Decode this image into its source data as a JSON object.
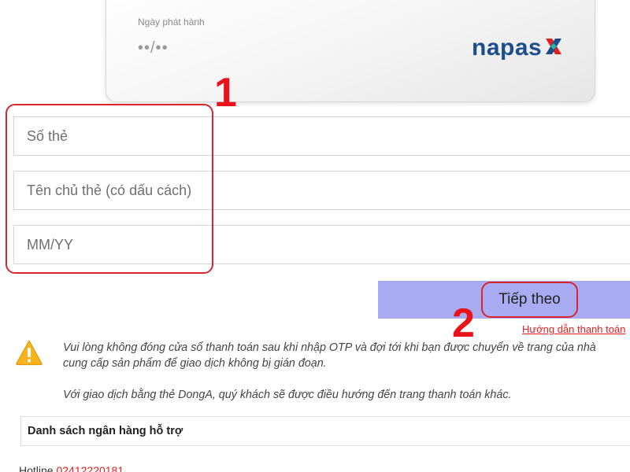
{
  "card": {
    "issue_date_label": "Ngày phát hành",
    "issue_date_value": "••/••",
    "brand": "napas"
  },
  "annotations": {
    "step1": "1",
    "step2": "2"
  },
  "form": {
    "card_number_placeholder": "Số thẻ",
    "card_holder_placeholder": "Tên chủ thẻ (có dấu cách)",
    "expiry_placeholder": "MM/YY",
    "continue_label": "Tiếp theo",
    "help_link": "Hướng dẫn thanh toán"
  },
  "notice": {
    "line1": "Vui lòng không đóng cửa sổ thanh toán sau khi nhập OTP và đợi tới khi bạn được chuyển về trang của nhà",
    "line2": "cung cấp sản phẩm để giao dịch không bị gián đoạn.",
    "line3": "Với giao dịch bằng thẻ DongA, quý khách sẽ được điều hướng đến trang thanh toán khác."
  },
  "bank_list": {
    "title": "Danh sách ngân hàng hỗ trợ"
  },
  "hotline": {
    "label": "Hotline",
    "number": "02412220181"
  },
  "colors": {
    "accent_red": "#e2201f",
    "button_bg": "#a8abf2",
    "napas_blue": "#1c4e8f",
    "warning_yellow": "#f5b41c"
  }
}
